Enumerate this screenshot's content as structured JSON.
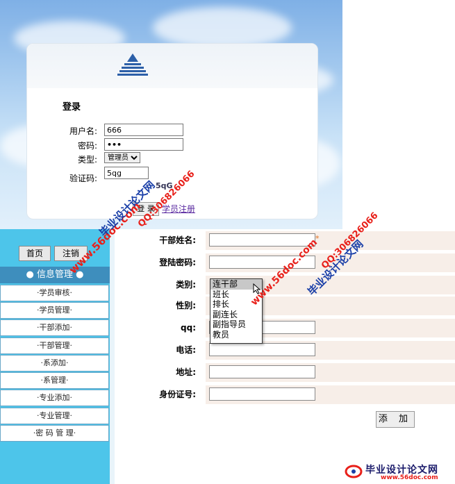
{
  "login": {
    "title": "登录",
    "username_label": "用户名:",
    "username_value": "666",
    "password_label": "密码:",
    "password_value": "•••",
    "type_label": "类型:",
    "type_selected": "管理员",
    "captcha_label": "验证码:",
    "captcha_value": "5qg",
    "captcha_image_text": "5qG",
    "login_button": "登 录",
    "register_link": "学员注册"
  },
  "top_buttons": {
    "home": "首页",
    "logout": "注销"
  },
  "menu": {
    "header": "● 信息管理 ●",
    "items": [
      "·学员审核·",
      "·学员管理·",
      "·干部添加·",
      "·干部管理·",
      "·系添加·",
      "·系管理·",
      "·专业添加·",
      "·专业管理·",
      "·密 码 管 理·"
    ]
  },
  "form": {
    "name_label": "干部姓名:",
    "name_required": "*",
    "password_label": "登陆密码:",
    "category_label": "类别:",
    "gender_label": "性别:",
    "qq_label": "qq:",
    "phone_label": "电话:",
    "address_label": "地址:",
    "id_label": "身份证号:",
    "category_options": [
      "连干部",
      "班长",
      "排长",
      "副连长",
      "副指导员",
      "教员"
    ],
    "add_button": "添 加"
  },
  "watermarks": {
    "site": "www.56doc.com",
    "brand": "毕业设计论文网",
    "qq": "QQ:306826066",
    "footer_brand": "毕业设计论文网",
    "footer_site": "www.56doc.com"
  },
  "colors": {
    "menu_panel": "#4dc5ea",
    "menu_header": "#3e8ebd",
    "form_value_bg": "#f7eee8",
    "watermark_red": "#e8201a",
    "watermark_blue": "#1a3fa8"
  }
}
